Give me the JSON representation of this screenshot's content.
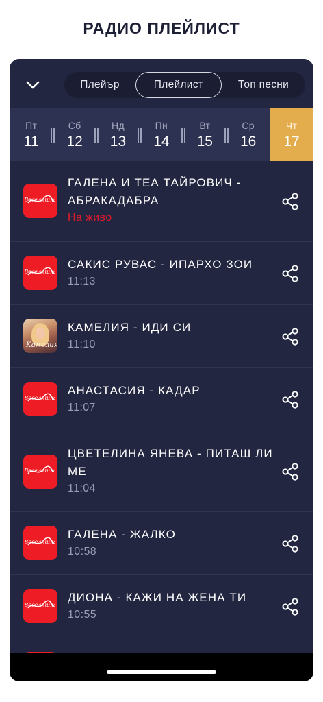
{
  "page": {
    "title": "РАДИО ПЛЕЙЛИСТ"
  },
  "nav": {
    "collapse_icon": "chevron-down-icon",
    "tabs": [
      {
        "label": "Плейър",
        "selected": false
      },
      {
        "label": "Плейлист",
        "selected": true
      },
      {
        "label": "Топ песни",
        "selected": false
      }
    ]
  },
  "days": [
    {
      "name": "Пт",
      "num": "11",
      "active": false
    },
    {
      "name": "Сб",
      "num": "12",
      "active": false
    },
    {
      "name": "Нд",
      "num": "13",
      "active": false
    },
    {
      "name": "Пн",
      "num": "14",
      "active": false
    },
    {
      "name": "Вт",
      "num": "15",
      "active": false
    },
    {
      "name": "Ср",
      "num": "16",
      "active": false
    },
    {
      "name": "Чт",
      "num": "17",
      "active": true
    }
  ],
  "playlist": [
    {
      "title": "ГАЛЕНА И ТЕА ТАЙРОВИЧ - АБРАКАДАБРА",
      "time": "На живо",
      "live": true,
      "cover": "radio-logo"
    },
    {
      "title": "САКИС РУВАС - ИПАРХО ЗОИ",
      "time": "11:13",
      "live": false,
      "cover": "radio-logo"
    },
    {
      "title": "КАМЕЛИЯ - ИДИ СИ",
      "time": "11:10",
      "live": false,
      "cover": "album-photo"
    },
    {
      "title": "АНАСТАСИЯ - КАДАР",
      "time": "11:07",
      "live": false,
      "cover": "radio-logo"
    },
    {
      "title": "ЦВЕТЕЛИНА ЯНЕВА - ПИТАШ ЛИ МЕ",
      "time": "11:04",
      "live": false,
      "cover": "radio-logo"
    },
    {
      "title": "ГАЛЕНА - ЖАЛКО",
      "time": "10:58",
      "live": false,
      "cover": "radio-logo"
    },
    {
      "title": "ДИОНА - КАЖИ НА ЖЕНА ТИ",
      "time": "10:55",
      "live": false,
      "cover": "radio-logo"
    }
  ],
  "logo_text": "Веселяшка",
  "album_script": "Камелия",
  "icons": {
    "share": "share-icon"
  },
  "colors": {
    "background": "#232641",
    "day_strip": "#2d3152",
    "active_day": "#e3ad4e",
    "logo_red": "#ee1c25",
    "live_red": "#e01a2c"
  }
}
